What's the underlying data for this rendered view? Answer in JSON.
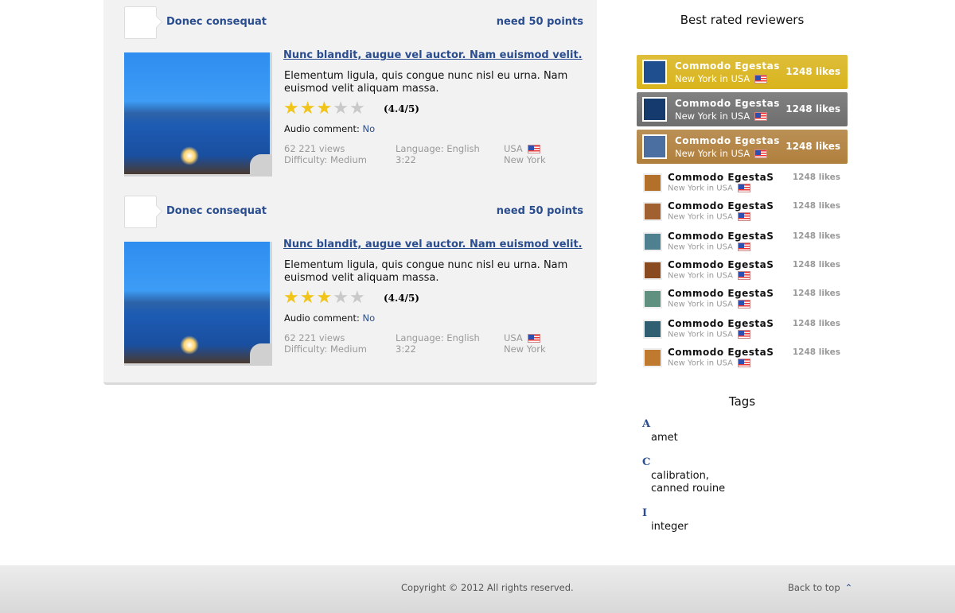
{
  "posts": [
    {
      "author": "Donec consequat",
      "points": "need 50 points",
      "title": "Nunc blandit, augue vel auctor. Nam euismod velit.",
      "description": "Elementum ligula, quis congue nunc nisl eu urna. Nam euismod velit aliquam massa.",
      "rating": 3,
      "rating_max": 5,
      "score": "(4.4/5)",
      "audio_label": "Audio comment:",
      "audio_value": "No",
      "views": "62 221 views",
      "difficulty": "Difficulty: Medium",
      "language": "Language: English",
      "duration": "3:22",
      "country": "USA",
      "city": "New York"
    },
    {
      "author": "Donec consequat",
      "points": "need 50 points",
      "title": "Nunc blandit, augue vel auctor. Nam euismod velit.",
      "description": "Elementum ligula, quis congue nunc nisl eu urna. Nam euismod velit aliquam massa.",
      "rating": 3,
      "rating_max": 5,
      "score": "(4.4/5)",
      "audio_label": "Audio comment:",
      "audio_value": "No",
      "views": "62 221 views",
      "difficulty": "Difficulty: Medium",
      "language": "Language: English",
      "duration": "3:22",
      "country": "USA",
      "city": "New York"
    }
  ],
  "sidebar": {
    "reviewers_title": "Best rated reviewers",
    "top": [
      {
        "name": "Commodo Egestas",
        "location": "New York in USA",
        "likes": "1248 likes",
        "color": "#d9b41c"
      },
      {
        "name": "Commodo Egestas",
        "location": "New York in USA",
        "likes": "1248 likes",
        "color": "#6e6e6e"
      },
      {
        "name": "Commodo Egestas",
        "location": "New York in USA",
        "likes": "1248 likes",
        "color": "#b07f3c"
      }
    ],
    "others": [
      {
        "name": "Commodo EgestaS",
        "location": "New York in USA",
        "likes": "1248 likes"
      },
      {
        "name": "Commodo EgestaS",
        "location": "New York in USA",
        "likes": "1248 likes"
      },
      {
        "name": "Commodo EgestaS",
        "location": "New York in USA",
        "likes": "1248 likes"
      },
      {
        "name": "Commodo EgestaS",
        "location": "New York in USA",
        "likes": "1248 likes"
      },
      {
        "name": "Commodo EgestaS",
        "location": "New York in USA",
        "likes": "1248 likes"
      },
      {
        "name": "Commodo EgestaS",
        "location": "New York in USA",
        "likes": "1248 likes"
      },
      {
        "name": "Commodo EgestaS",
        "location": "New York in USA",
        "likes": "1248 likes"
      }
    ],
    "tags_title": "Tags",
    "tags": [
      {
        "letter": "A",
        "items": [
          "amet"
        ]
      },
      {
        "letter": "C",
        "items": [
          "calibration,",
          "canned rouine"
        ]
      },
      {
        "letter": "I",
        "items": [
          "integer"
        ]
      }
    ]
  },
  "footer": {
    "copyright": "Copyright © 2012 All rights reserved.",
    "back_to_top": "Back to top"
  }
}
